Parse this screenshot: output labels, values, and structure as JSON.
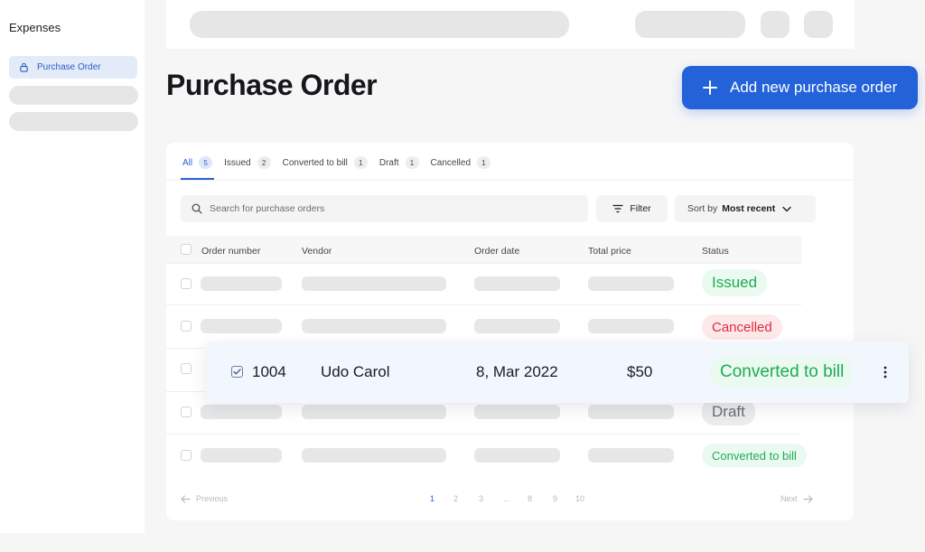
{
  "sidebar": {
    "title": "Expenses",
    "active_item": {
      "label": "Purchase Order",
      "icon": "lock-icon"
    }
  },
  "page": {
    "title": "Purchase Order"
  },
  "add_button": {
    "label": "Add new purchase order",
    "icon": "plus-icon"
  },
  "tabs": [
    {
      "label": "All",
      "count": "5"
    },
    {
      "label": "Issued",
      "count": "2"
    },
    {
      "label": "Converted to bill",
      "count": "1"
    },
    {
      "label": "Draft",
      "count": "1"
    },
    {
      "label": "Cancelled",
      "count": "1"
    }
  ],
  "search": {
    "placeholder": "Search for purchase orders",
    "icon": "search-icon"
  },
  "filter": {
    "label": "Filter",
    "icon": "filter-icon"
  },
  "sort": {
    "prefix": "Sort by",
    "value": "Most recent",
    "icon": "chevron-down-icon"
  },
  "table": {
    "columns": [
      "Order number",
      "Vendor",
      "Order date",
      "Total price",
      "Status"
    ],
    "row_statuses": [
      "Issued",
      "Cancelled",
      "",
      "Draft",
      "Converted to bill"
    ]
  },
  "highlighted_row": {
    "order_number": "1004",
    "vendor": "Udo Carol",
    "order_date": "8, Mar 2022",
    "total_price": "$50",
    "status": "Converted to bill"
  },
  "pagination": {
    "previous": "Previous",
    "next": "Next",
    "pages": [
      "1",
      "2",
      "3",
      "...",
      "8",
      "9",
      "10"
    ],
    "current": "1"
  },
  "colors": {
    "accent": "#2362d8",
    "green": "#1eab55",
    "red": "#df2a3b",
    "gray": "#6b6e75"
  }
}
